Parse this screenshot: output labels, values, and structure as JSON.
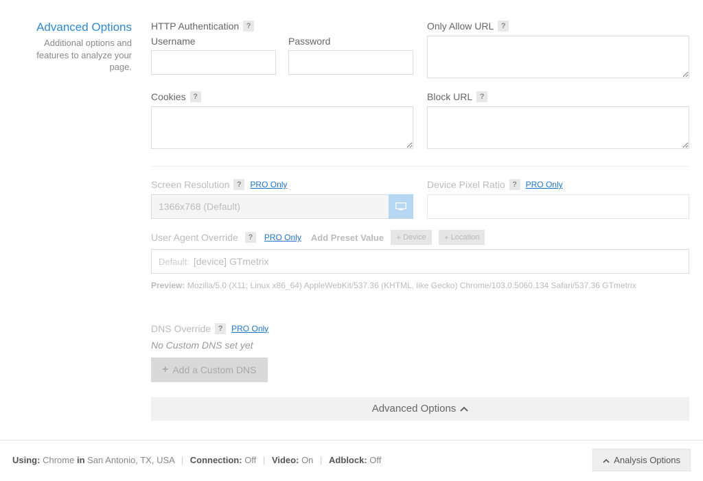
{
  "sidebar": {
    "title": "Advanced Options",
    "desc": "Additional options and features to analyze your page."
  },
  "pro_link": "PRO Only",
  "http_auth": {
    "label": "HTTP Authentication",
    "username_label": "Username",
    "password_label": "Password"
  },
  "only_allow": {
    "label": "Only Allow URL"
  },
  "cookies": {
    "label": "Cookies"
  },
  "block_url": {
    "label": "Block URL"
  },
  "screen_res": {
    "label": "Screen Resolution",
    "value": "1366x768 (Default)"
  },
  "dpr": {
    "label": "Device Pixel Ratio"
  },
  "ua": {
    "label": "User Agent Override",
    "add_preset": "Add Preset Value",
    "device_btn": "Device",
    "location_btn": "Location",
    "default_text": "Default:",
    "device_text": "[device] GTmetrix",
    "preview_label": "Preview:",
    "preview_value": "Mozilla/5.0 (X11; Linux x86_64) AppleWebKit/537.36 (KHTML, like Gecko) Chrome/103.0.5060.134 Safari/537.36 GTmetrix"
  },
  "dns": {
    "label": "DNS Override",
    "status": "No Custom DNS set yet",
    "add_btn": "Add a Custom DNS"
  },
  "toggle": {
    "label": "Advanced Options"
  },
  "footer": {
    "using_label": "Using:",
    "browser": "Chrome",
    "in_label": "in",
    "location": "San Antonio, TX, USA",
    "connection_label": "Connection:",
    "connection_value": "Off",
    "video_label": "Video:",
    "video_value": "On",
    "adblock_label": "Adblock:",
    "adblock_value": "Off",
    "options_btn": "Analysis Options"
  }
}
